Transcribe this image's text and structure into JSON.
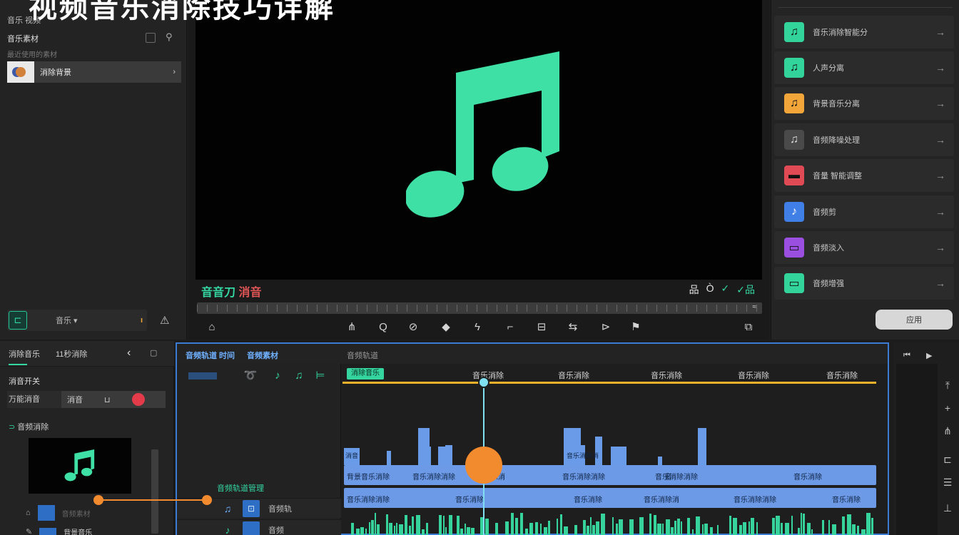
{
  "title": "视频音乐消除技巧详解",
  "left_panel": {
    "header_small": "音乐 视频",
    "section_label": "音乐素材",
    "subtitle": "最近使用的素材",
    "selected_item": "消除背景",
    "bottom_label": "音乐 ▾"
  },
  "preview": {
    "label_green": "音音刀",
    "label_red": "消音",
    "right_icons": [
      "品",
      "Ò",
      "✓",
      "✓品"
    ]
  },
  "right_panel": {
    "items": [
      {
        "label": "音乐消除智能分",
        "color": "#33d49b",
        "glyph": "♫",
        "arrow": "→"
      },
      {
        "label": "人声分离",
        "color": "#33d49b",
        "glyph": "♫",
        "arrow": "→"
      },
      {
        "label": "背景音乐分离",
        "color": "#f2a63a",
        "glyph": "♫",
        "arrow": "→"
      },
      {
        "label": "音频降噪处理",
        "color": "#4a4a4a",
        "glyph": "♫",
        "arrow": "→"
      },
      {
        "label": "音量 智能调整",
        "color": "#e04a55",
        "glyph": "▬",
        "arrow": "→"
      },
      {
        "label": "音频剪",
        "color": "#3f7fe6",
        "glyph": "♪",
        "arrow": "→"
      },
      {
        "label": "音频淡入",
        "color": "#9a4fe0",
        "glyph": "▭",
        "arrow": "→"
      },
      {
        "label": "音频增强",
        "color": "#33d49b",
        "glyph": "▭",
        "arrow": "→"
      }
    ],
    "action_button": "应用"
  },
  "bottom_left": {
    "tab1": "消除音乐",
    "tab2": "11秒消除",
    "section": "消音开关",
    "row_key": "万能消音",
    "row_value": "消音",
    "row_icon": "⊔",
    "list_title": "音频消除",
    "track1_label": "音频素材",
    "track2_label": "背景音乐"
  },
  "timeline": {
    "header_left": "音频轨道 时间",
    "header_mid": "音频素材",
    "header_right": "音频轨道",
    "chip": "消除音乐",
    "ruler_labels": [
      "音乐消除",
      "音乐消除",
      "音乐消除",
      "音乐消除",
      "音乐消除"
    ],
    "track_group_label": "音频轨道管理",
    "tracks": [
      {
        "icon": "♫",
        "label": "音频轨"
      },
      {
        "icon": "♪",
        "label": "音频"
      }
    ],
    "clip1_labels": [
      "背景音乐消除",
      "音乐消除消除",
      "音乐消",
      "音乐消除消除",
      "音乐消除消除",
      "音",
      "音乐消除"
    ],
    "clip2_labels": [
      "音乐消除消除",
      "音乐消除",
      "音乐消除",
      "音乐消除消",
      "音乐消除消除",
      "音乐消除"
    ],
    "bar_label1": "消音",
    "bar_label2": "音乐消除消"
  }
}
